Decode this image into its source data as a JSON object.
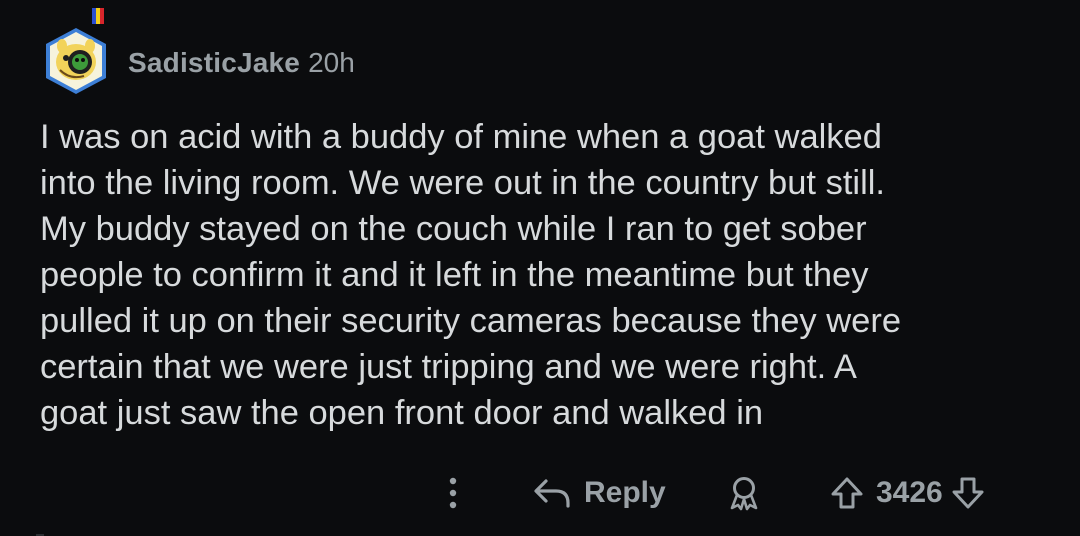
{
  "comment": {
    "author": "SadisticJake",
    "time_ago": "20h",
    "body": "I was on acid with a buddy of mine when a goat walked\ninto the living room. We were out in the country but still.\nMy buddy stayed on the couch while I ran to get sober\npeople to confirm it and it left in the meantime but they\npulled it up on their security cameras because they were\ncertain that we were just tripping and we were right. A\ngoat just saw the open front door and walked in"
  },
  "actions": {
    "reply_label": "Reply",
    "score": "3426"
  },
  "icons": {
    "more": "more-vertical-icon",
    "reply": "reply-arrow-icon",
    "award": "award-icon",
    "upvote": "upvote-arrow-icon",
    "downvote": "downvote-arrow-icon"
  },
  "colors": {
    "background": "#0b0c0e",
    "text": "#d7dadc",
    "muted": "#9aa1a6"
  }
}
